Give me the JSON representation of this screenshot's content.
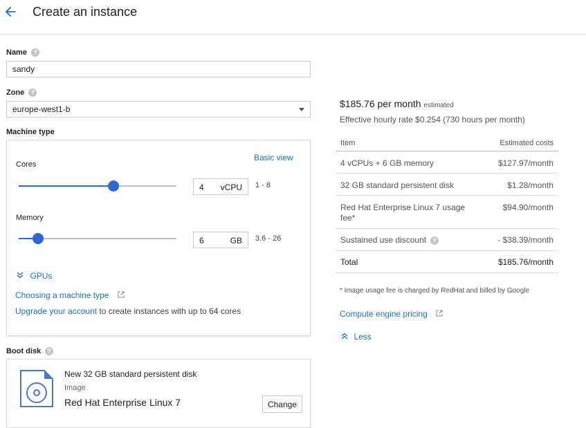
{
  "header": {
    "title": "Create an instance"
  },
  "name": {
    "label": "Name",
    "value": "sandy"
  },
  "zone": {
    "label": "Zone",
    "value": "europe-west1-b"
  },
  "machine": {
    "label": "Machine type",
    "basic_view": "Basic view",
    "cores": {
      "label": "Cores",
      "value": "4",
      "unit": "vCPU",
      "range": "1 - 8",
      "min": 1,
      "max": 8
    },
    "memory": {
      "label": "Memory",
      "value": "6",
      "unit": "GB",
      "range": "3.6 - 26",
      "min": 3.6,
      "max": 26
    },
    "gpus": "GPUs",
    "choosing_link": "Choosing a machine type",
    "upgrade_link": "Upgrade your account",
    "upgrade_text": " to create instances with up to 64 cores"
  },
  "boot": {
    "label": "Boot disk",
    "disk_title": "New 32 GB standard persistent disk",
    "image_label": "Image",
    "image_name": "Red Hat Enterprise Linux 7",
    "change": "Change"
  },
  "cost": {
    "price": "$185.76 per month",
    "estimated": "estimated",
    "hourly": "Effective hourly rate $0.254 (730 hours per month)",
    "col_item": "Item",
    "col_cost": "Estimated costs",
    "rows": [
      {
        "item": "4 vCPUs + 6 GB memory",
        "cost": "$127.97/month"
      },
      {
        "item": "32 GB standard persistent disk",
        "cost": "$1.28/month"
      },
      {
        "item": "Red Hat Enterprise Linux 7 usage",
        "item2": "fee*",
        "cost": "$94.90/month"
      },
      {
        "item": "Sustained use discount",
        "cost": "- $38.39/month"
      },
      {
        "item": "Total",
        "cost": "$185.76/month"
      }
    ],
    "footnote": "* Image usage fee is charged by RedHat and billed by Google",
    "pricing_link": "Compute engine pricing",
    "less": "Less"
  }
}
